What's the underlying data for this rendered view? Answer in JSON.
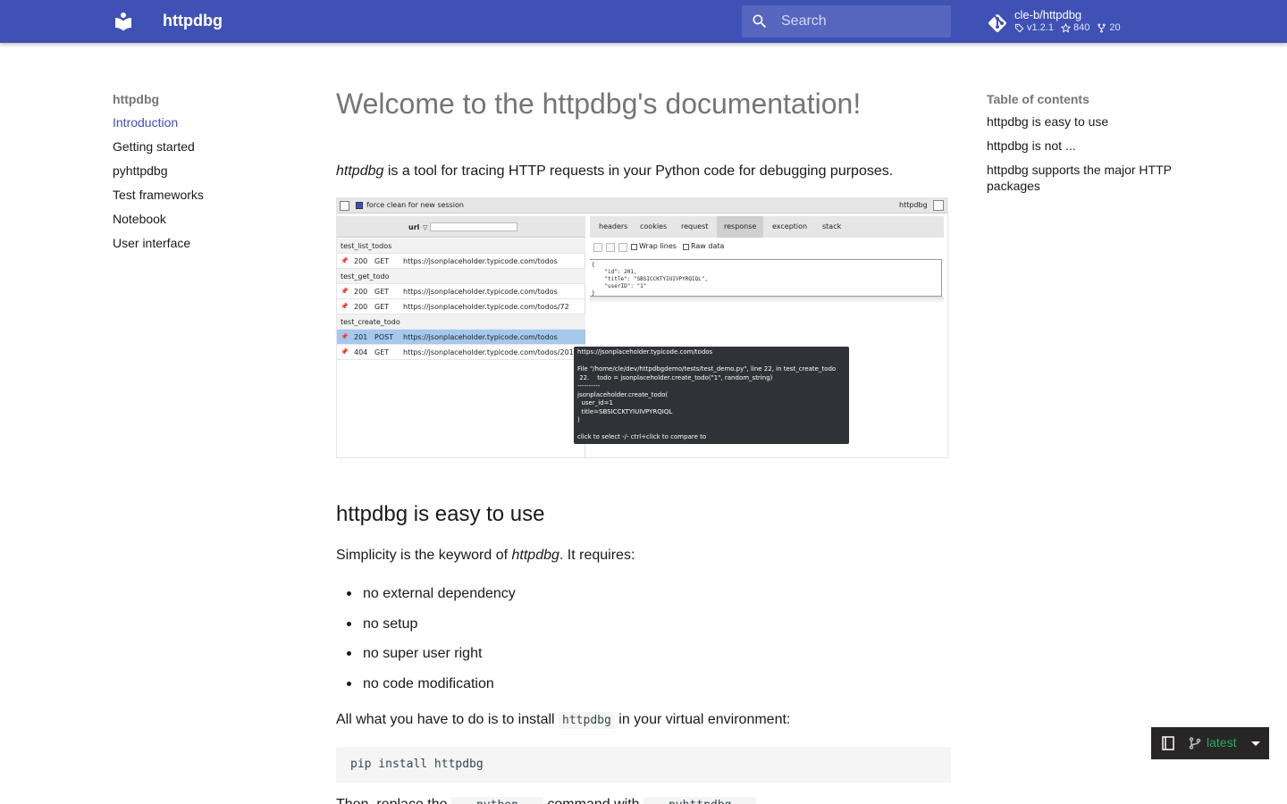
{
  "header": {
    "site_title": "httpdbg",
    "search_placeholder": "Search",
    "repo": {
      "name": "cle-b/httpdbg",
      "version": "v1.2.1",
      "stars": "840",
      "forks": "20"
    }
  },
  "nav": {
    "title": "httpdbg",
    "items": [
      {
        "label": "Introduction",
        "active": true
      },
      {
        "label": "Getting started"
      },
      {
        "label": "pyhttpdbg"
      },
      {
        "label": "Test frameworks"
      },
      {
        "label": "Notebook"
      },
      {
        "label": "User interface"
      }
    ]
  },
  "toc": {
    "title": "Table of contents",
    "items": [
      {
        "label": "httpdbg is easy to use"
      },
      {
        "label": "httpdbg is not ..."
      },
      {
        "label": "httpdbg supports the major HTTP packages"
      }
    ]
  },
  "content": {
    "h1": "Welcome to the httpdbg's documentation!",
    "intro_em": "httpdbg",
    "intro_rest": " is a tool for tracing HTTP requests in your Python code for debugging purposes.",
    "h2": "httpdbg is easy to use",
    "p1_pre": "Simplicity is the keyword of ",
    "p1_em": "httpdbg",
    "p1_post": ". It requires:",
    "bullets": [
      "no external dependency",
      "no setup",
      "no super user right",
      "no code modification"
    ],
    "p2_pre": "All what you have to do is to install ",
    "p2_code": "httpdbg",
    "p2_post": " in your virtual environment:",
    "code_block": "pip install httpdbg",
    "p3_pre": "Then, replace the ",
    "p3_code1": "python",
    "p3_mid": " command with ",
    "p3_code2": "pyhttpdbg"
  },
  "screenshot": {
    "force_clean_label": "force clean for new session",
    "app_label": "httpdbg",
    "url_label": "url",
    "groups": [
      {
        "name": "test_list_todos",
        "rows": [
          {
            "status": "200",
            "method": "GET",
            "url": "https://jsonplaceholder.typicode.com/todos"
          }
        ]
      },
      {
        "name": "test_get_todo",
        "rows": [
          {
            "status": "200",
            "method": "GET",
            "url": "https://jsonplaceholder.typicode.com/todos"
          },
          {
            "status": "200",
            "method": "GET",
            "url": "https://jsonplaceholder.typicode.com/todos/72"
          }
        ]
      },
      {
        "name": "test_create_todo",
        "rows": [
          {
            "status": "201",
            "method": "POST",
            "url": "https://jsonplaceholder.typicode.com/todos",
            "selected": true
          },
          {
            "status": "404",
            "method": "GET",
            "url": "https://jsonplaceholder.typicode.com/todos/201"
          }
        ]
      }
    ],
    "tabs": [
      "headers",
      "cookies",
      "request",
      "response",
      "exception",
      "stack"
    ],
    "active_tab": "response",
    "wrap_lines_label": "Wrap lines",
    "raw_data_label": "Raw data",
    "json_body": "{\n    \"id\": 201,\n    \"title\": \"SBSICCKTYIUIVPYRQIQL\",\n    \"userID\": \"1\"\n}",
    "tooltip": "https://jsonplaceholder.typicode.com/todos\n\nFile \"/home/cle/dev/httpdbgdemo/tests/test_demo.py\", line 22, in test_create_todo\n 22.    todo = jsonplaceholder.create_todo(\"1\", random_string)\n----------\njsonplaceholder.create_todo(\n  user_id=1\n  title=SBSICCKTYIUIVPYRQIQL\n)\n\nclick to select -/- ctrl+click to compare to"
  },
  "version_badge": {
    "label": "latest"
  },
  "colors": {
    "primary": "#3f51b5",
    "badge_bg": "#272525",
    "version_green": "#27ae60"
  }
}
